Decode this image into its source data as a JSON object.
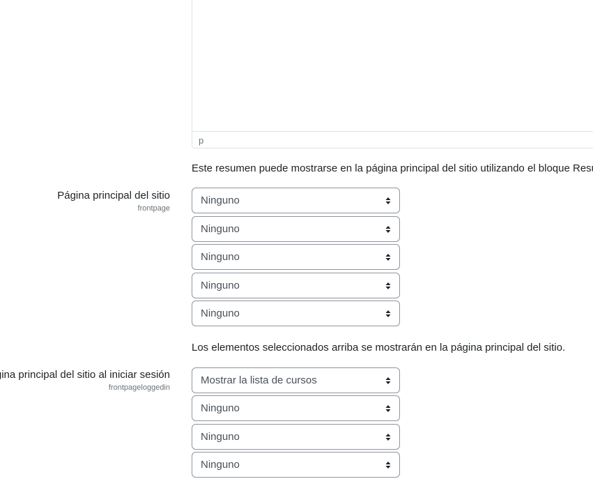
{
  "editor": {
    "status_path": "p"
  },
  "summary_description": "Este resumen puede mostrarse en la página principal del sitio utilizando el bloque Resu",
  "frontpage": {
    "title": "Página principal del sitio",
    "key": "frontpage",
    "selects": [
      "Ninguno",
      "Ninguno",
      "Ninguno",
      "Ninguno",
      "Ninguno"
    ],
    "description": "Los elementos seleccionados arriba se mostrarán en la página principal del sitio."
  },
  "frontpageloggedin": {
    "title": "gina principal del sitio al iniciar sesión",
    "key": "frontpageloggedin",
    "selects": [
      "Mostrar la lista de cursos",
      "Ninguno",
      "Ninguno",
      "Ninguno"
    ]
  },
  "icons": {
    "caret": "sort-caret-icon"
  },
  "colors": {
    "text": "#1d2125",
    "muted": "#6a737b",
    "select_border": "#8f959e"
  }
}
